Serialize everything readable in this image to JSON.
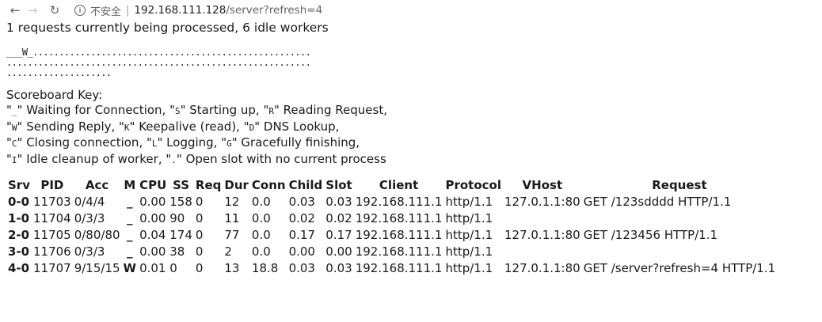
{
  "browser": {
    "security_label": "不安全",
    "separator": "|",
    "url_host": "192.168.111.128",
    "url_path": "/server?refresh=4"
  },
  "status": {
    "summary": "1 requests currently being processed, 6 idle workers"
  },
  "scoreboard": {
    "lines": [
      "___W_.....................................................",
      "..........................................................",
      "...................."
    ]
  },
  "key": {
    "title": "Scoreboard Key:",
    "lines": [
      [
        {
          "t": "\""
        },
        {
          "k": "_"
        },
        {
          "t": "\" Waiting for Connection, \""
        },
        {
          "k": "S"
        },
        {
          "t": "\" Starting up, \""
        },
        {
          "k": "R"
        },
        {
          "t": "\" Reading Request,"
        }
      ],
      [
        {
          "t": "\""
        },
        {
          "k": "W"
        },
        {
          "t": "\" Sending Reply, \""
        },
        {
          "k": "K"
        },
        {
          "t": "\" Keepalive (read), \""
        },
        {
          "k": "D"
        },
        {
          "t": "\" DNS Lookup,"
        }
      ],
      [
        {
          "t": "\""
        },
        {
          "k": "C"
        },
        {
          "t": "\" Closing connection, \""
        },
        {
          "k": "L"
        },
        {
          "t": "\" Logging, \""
        },
        {
          "k": "G"
        },
        {
          "t": "\" Gracefully finishing,"
        }
      ],
      [
        {
          "t": "\""
        },
        {
          "k": "I"
        },
        {
          "t": "\" Idle cleanup of worker, \""
        },
        {
          "k": "."
        },
        {
          "t": "\" Open slot with no current process"
        }
      ]
    ]
  },
  "table": {
    "headers": [
      "Srv",
      "PID",
      "Acc",
      "M",
      "CPU",
      "SS",
      "Req",
      "Dur",
      "Conn",
      "Child",
      "Slot",
      "Client",
      "Protocol",
      "VHost",
      "Request"
    ],
    "rows": [
      [
        "0-0",
        "11703",
        "0/4/4",
        "_",
        "0.00",
        "158",
        "0",
        "12",
        "0.0",
        "0.03",
        "0.03",
        "192.168.111.1",
        "http/1.1",
        "127.0.1.1:80",
        "GET /123sdddd HTTP/1.1"
      ],
      [
        "1-0",
        "11704",
        "0/3/3",
        "_",
        "0.00",
        "90",
        "0",
        "11",
        "0.0",
        "0.02",
        "0.02",
        "192.168.111.1",
        "http/1.1",
        "",
        ""
      ],
      [
        "2-0",
        "11705",
        "0/80/80",
        "_",
        "0.04",
        "174",
        "0",
        "77",
        "0.0",
        "0.17",
        "0.17",
        "192.168.111.1",
        "http/1.1",
        "127.0.1.1:80",
        "GET /123456 HTTP/1.1"
      ],
      [
        "3-0",
        "11706",
        "0/3/3",
        "_",
        "0.00",
        "38",
        "0",
        "2",
        "0.0",
        "0.00",
        "0.00",
        "192.168.111.1",
        "http/1.1",
        "",
        ""
      ],
      [
        "4-0",
        "11707",
        "9/15/15",
        "W",
        "0.01",
        "0",
        "0",
        "13",
        "18.8",
        "0.03",
        "0.03",
        "192.168.111.1",
        "http/1.1",
        "127.0.1.1:80",
        "GET /server?refresh=4 HTTP/1.1"
      ]
    ]
  }
}
